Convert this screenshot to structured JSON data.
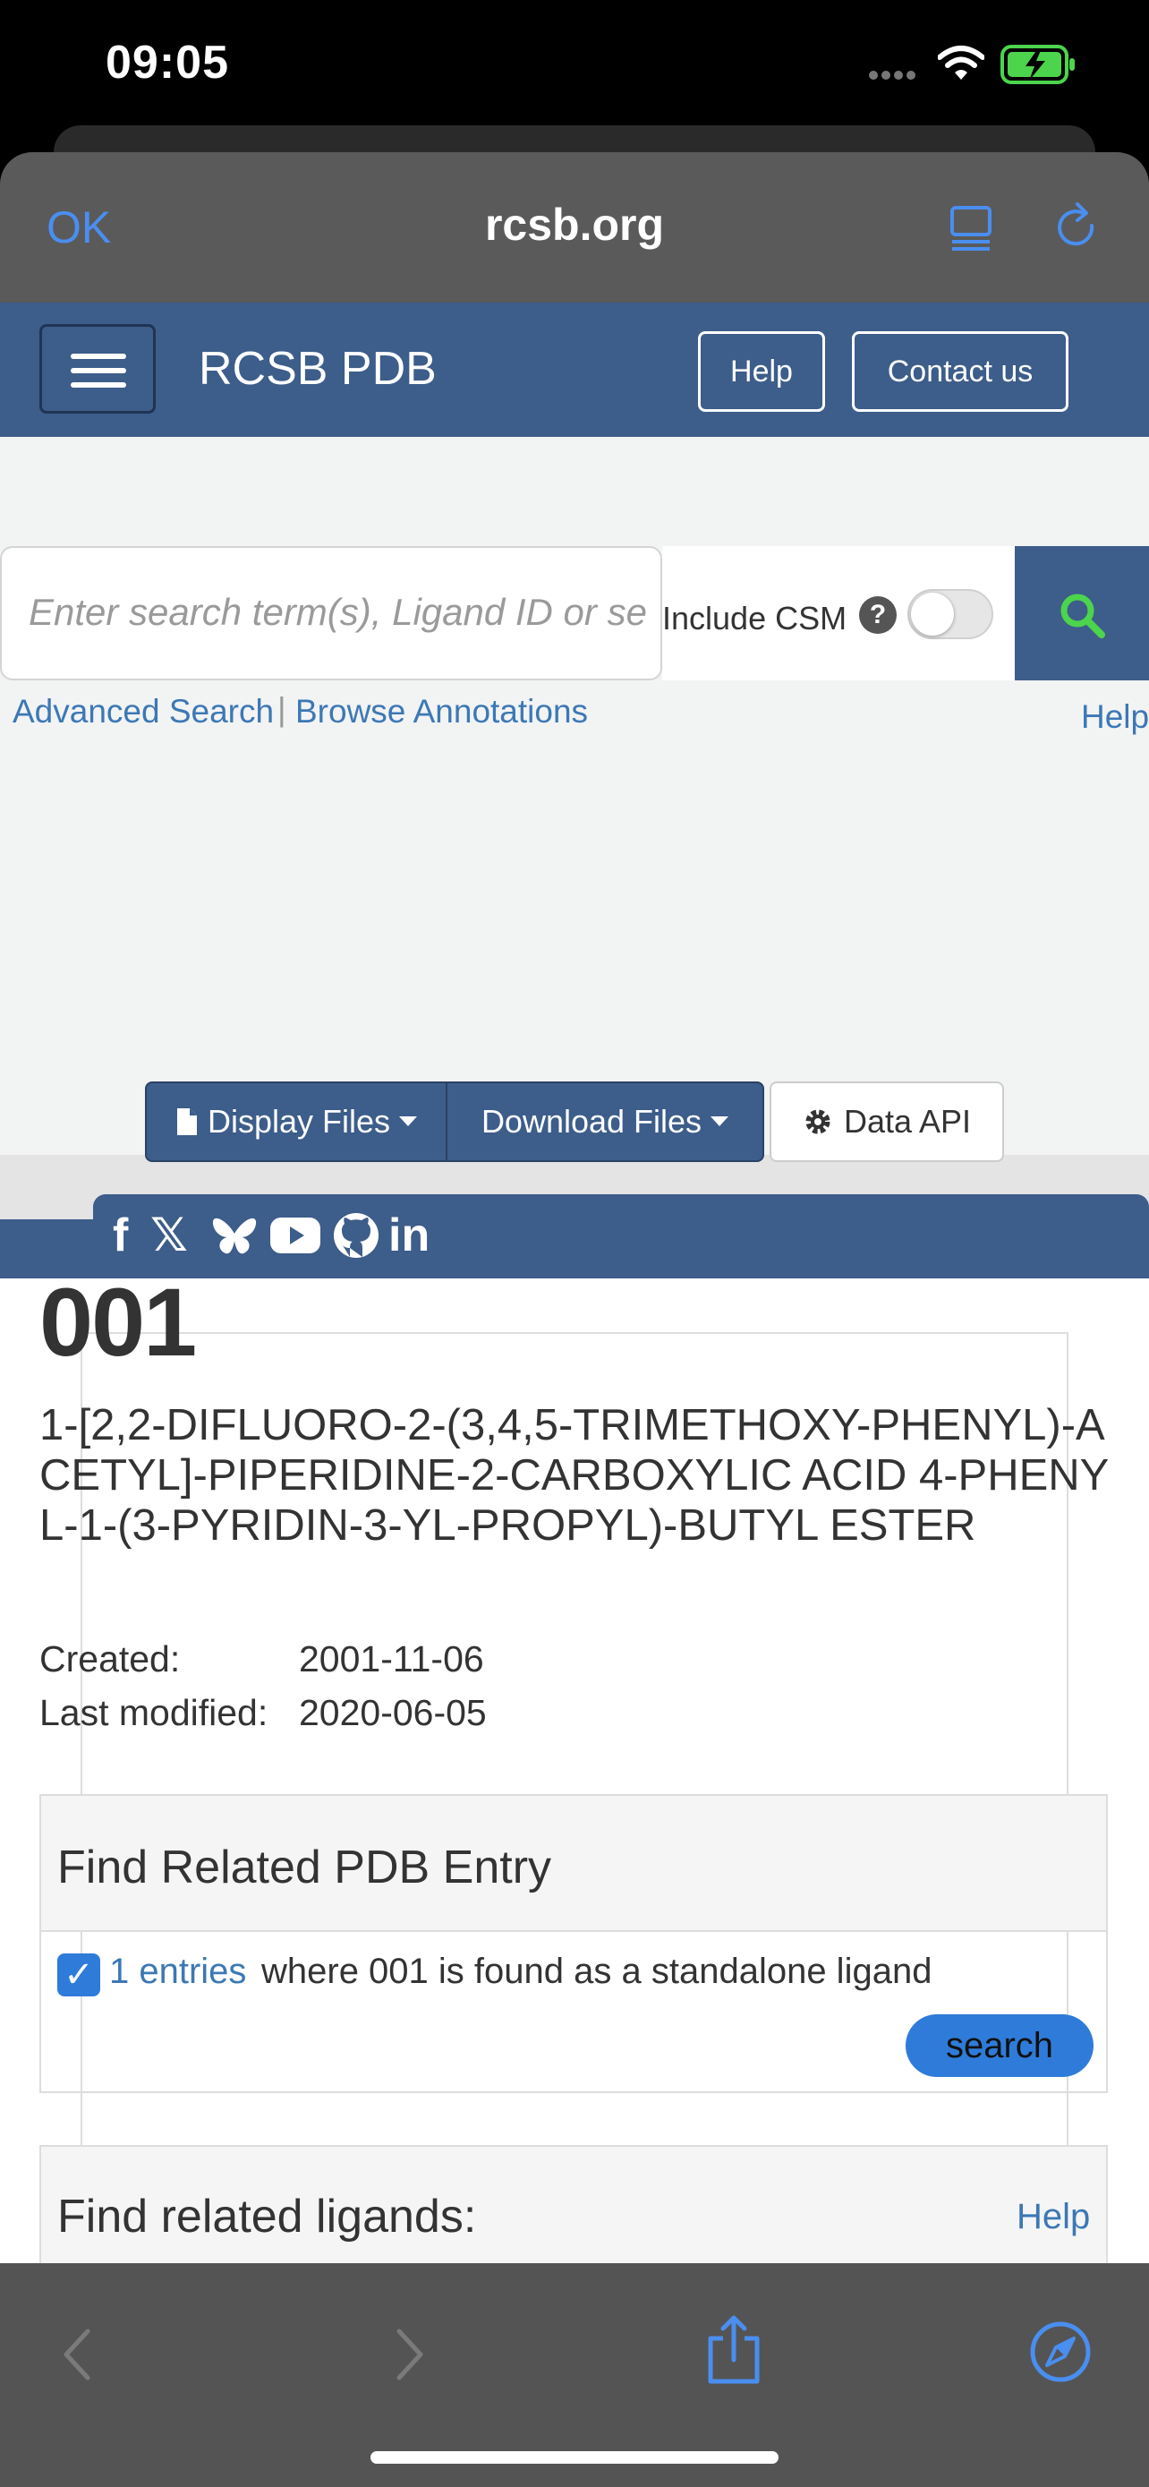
{
  "status_bar": {
    "time": "09:05"
  },
  "browser": {
    "done_label": "OK",
    "url": "rcsb.org"
  },
  "navbar": {
    "brand": "RCSB PDB",
    "help": "Help",
    "contact": "Contact us"
  },
  "search": {
    "placeholder": "Enter search term(s), Ligand ID or se",
    "include_csm": "Include CSM",
    "csm_help": "?",
    "advanced": "Advanced Search",
    "separator": "|",
    "browse": "Browse Annotations",
    "help": "Help"
  },
  "social": {
    "items": [
      "f",
      "𝕏",
      "in"
    ]
  },
  "files": {
    "display": "Display Files",
    "download": "Download Files",
    "data_api": "Data API"
  },
  "ligand": {
    "id": "001",
    "name": "1-[2,2-DIFLUORO-2-(3,4,5-TRIMETHOXY-PHENYL)-ACETYL]-PIPERIDINE-2-CARBOXYLIC ACID 4-PHENYL-1-(3-PYRIDIN-3-YL-PROPYL)-BUTYL ESTER",
    "created_label": "Created:",
    "created": "2001-11-06",
    "modified_label": "Last modified:",
    "modified": "2020-06-05"
  },
  "related_entry": {
    "title": "Find Related PDB Entry",
    "link": "1 entries",
    "text": "where 001 is found as a standalone ligand",
    "button": "search"
  },
  "related_ligands": {
    "title": "Find related ligands:",
    "help": "Help"
  },
  "colors": {
    "brand_blue": "#3d5d8a",
    "link_blue": "#3c78b5",
    "accent_blue": "#2f7bd9",
    "search_icon_green": "#4cd44c"
  }
}
